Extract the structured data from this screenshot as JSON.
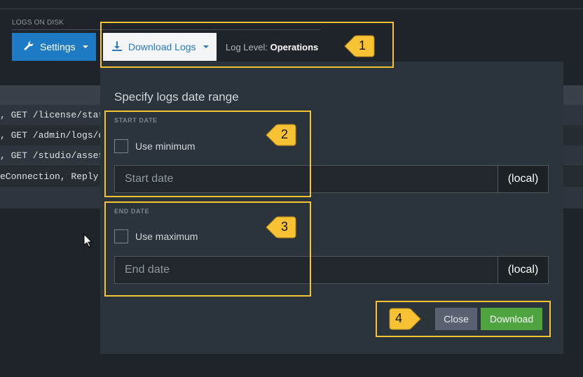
{
  "header": {
    "section_label": "LOGS ON DISK",
    "settings_label": "Settings",
    "download_logs_label": "Download Logs",
    "log_level_label": "Log Level:",
    "log_level_value": "Operations"
  },
  "log_rows": [
    ", GET /license/stat",
    ", GET /admin/logs/d",
    ", GET /studio/asset",
    "eConnection, Reply:"
  ],
  "panel": {
    "title": "Specify logs date range",
    "start": {
      "label": "START DATE",
      "checkbox_label": "Use minimum",
      "placeholder": "Start date",
      "addon": "(local)"
    },
    "end": {
      "label": "END DATE",
      "checkbox_label": "Use maximum",
      "placeholder": "End date",
      "addon": "(local)"
    },
    "close_label": "Close",
    "download_label": "Download"
  },
  "callouts": [
    "1",
    "2",
    "3",
    "4"
  ],
  "colors": {
    "accent_blue": "#1f7ac4",
    "success_green": "#4ea540",
    "highlight": "#f7c233"
  },
  "icons": [
    "wrench-icon",
    "download-icon",
    "pointer-cursor-icon"
  ]
}
